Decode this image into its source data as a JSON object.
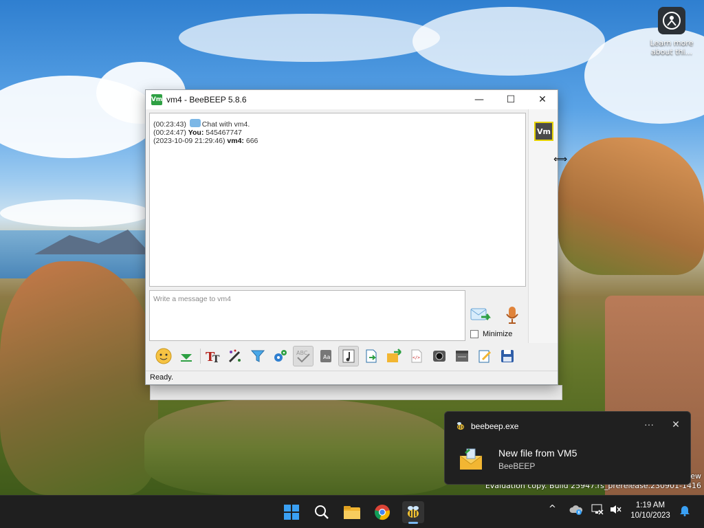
{
  "desktop": {
    "icon_label": "Learn more about thi...",
    "watermark_line1": "ew",
    "watermark_line2": "Evaluation copy. Build 25947.rs_prerelease.230901-1416"
  },
  "window": {
    "logo_text": "Vm",
    "title": "vm4 - BeeBEEP 5.8.6",
    "minimize_glyph": "—",
    "maximize_glyph": "☐",
    "close_glyph": "✕"
  },
  "chat": {
    "messages": [
      {
        "time": "(00:23:43)",
        "sender": "",
        "text": "Chat with vm4."
      },
      {
        "time": "(00:24:47)",
        "sender": "You:",
        "text": "545467747"
      },
      {
        "time": "(2023-10-09 21:29:46)",
        "sender": "vm4:",
        "text": "666"
      }
    ]
  },
  "input": {
    "placeholder": "Write a message to vm4"
  },
  "controls": {
    "minimize_label": "Minimize"
  },
  "sidebar": {
    "user_avatar_text": "Vm"
  },
  "toolbar": {
    "tools": [
      "emoticons-icon",
      "collapse-icon",
      "font-icon",
      "color-icon",
      "filter-icon",
      "settings-icon",
      "spellcheck-icon",
      "dictionary-icon",
      "sound-icon",
      "save-chat-icon",
      "send-file-icon",
      "html-icon",
      "screenshot-icon",
      "clear-icon",
      "edit-icon",
      "save-icon"
    ]
  },
  "status": {
    "text": "Ready."
  },
  "toast": {
    "app": "beebeep.exe",
    "more_glyph": "···",
    "close_glyph": "✕",
    "title": "New file from VM5",
    "subtitle": "BeeBEEP"
  },
  "taskbar": {
    "time": "1:19 AM",
    "date": "10/10/2023"
  },
  "colors": {
    "accent": "#2ea043",
    "avatar_border": "#e6d200",
    "taskbar_bg": "#1f1f1f",
    "toast_bg": "#202020"
  }
}
